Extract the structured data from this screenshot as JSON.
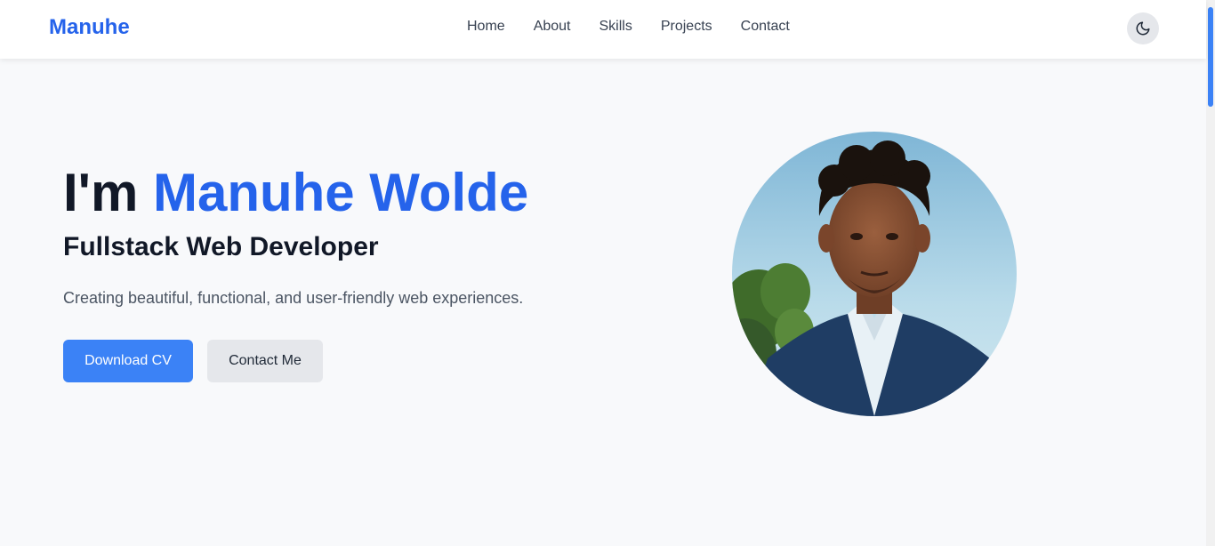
{
  "nav": {
    "brand": "Manuhe",
    "links": [
      "Home",
      "About",
      "Skills",
      "Projects",
      "Contact"
    ],
    "theme_toggle_icon": "moon-icon"
  },
  "hero": {
    "greeting": "I'm",
    "name": "Manuhe Wolde",
    "subtitle": "Fullstack Web Developer",
    "description": "Creating beautiful, functional, and user-friendly web experiences.",
    "primary_button": "Download CV",
    "secondary_button": "Contact Me"
  },
  "colors": {
    "accent": "#2563eb",
    "button_primary": "#3b82f6",
    "button_secondary": "#e5e7eb",
    "background": "#f8f9fb"
  }
}
